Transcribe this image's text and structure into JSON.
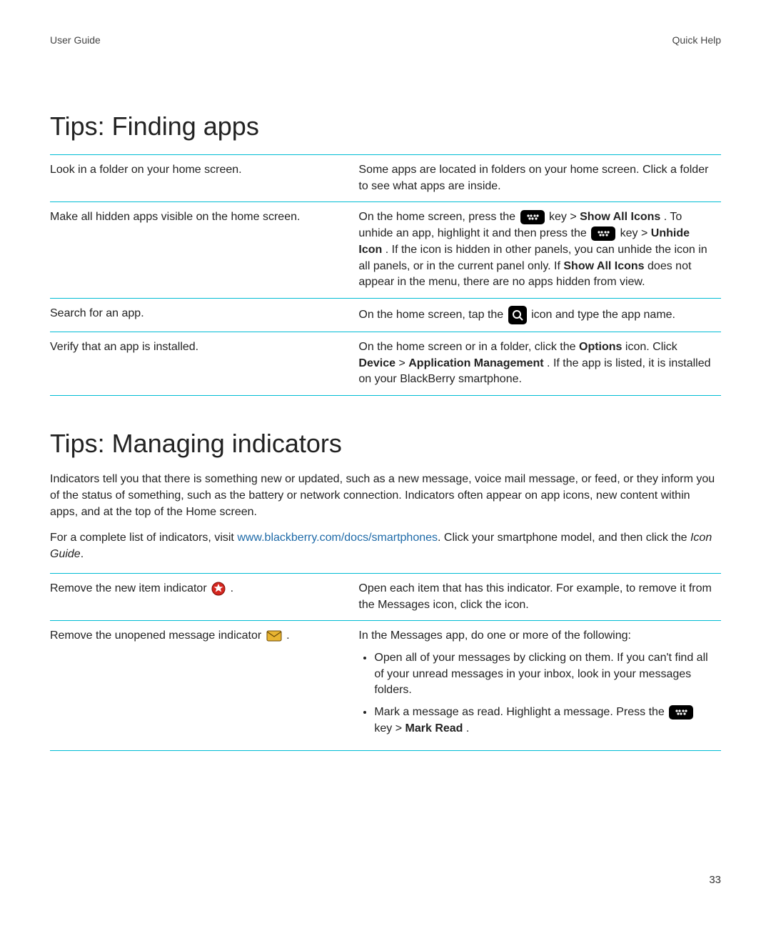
{
  "header": {
    "left": "User Guide",
    "right": "Quick Help"
  },
  "page_number": "33",
  "section1": {
    "title": "Tips: Finding apps",
    "rows": [
      {
        "left": "Look in a folder on your home screen.",
        "right_plain": "Some apps are located in folders on your home screen. Click a folder to see what apps are inside."
      },
      {
        "left": "Make all hidden apps visible on the home screen.",
        "r2a": "On the home screen, press the ",
        "r2b": " key > ",
        "r2c": "Show All Icons",
        "r2d": ". To unhide an app, highlight it and then press the ",
        "r2e": " key > ",
        "r2f": "Unhide Icon",
        "r2g": ". If the icon is hidden in other panels, you can unhide the icon in all panels, or in the current panel only. If ",
        "r2h": "Show All Icons",
        "r2i": " does not appear in the menu, there are no apps hidden from view."
      },
      {
        "left": "Search for an app.",
        "r3a": "On the home screen, tap the ",
        "r3b": " icon and type the app name."
      },
      {
        "left": "Verify that an app is installed.",
        "r4a": "On the home screen or in a folder, click the ",
        "r4b": "Options",
        "r4c": " icon. Click ",
        "r4d": "Device",
        "r4e": " > ",
        "r4f": "Application Management",
        "r4g": ". If the app is listed, it is installed on your BlackBerry smartphone."
      }
    ]
  },
  "section2": {
    "title": "Tips: Managing indicators",
    "intro": "Indicators tell you that there is something new or updated, such as a new message, voice mail message, or feed, or they inform you of the status of something, such as the battery or network connection. Indicators often appear on app icons, new content within apps, and at the top of the Home screen.",
    "link_pre": "For a complete list of indicators, visit ",
    "link_text": "www.blackberry.com/docs/smartphones",
    "link_post_a": ". Click your smartphone model, and then click the ",
    "link_post_italic": "Icon Guide",
    "link_post_b": ".",
    "rows": [
      {
        "left_a": "Remove the new item indicator ",
        "left_b": " .",
        "right": "Open each item that has this indicator. For example, to remove it from the Messages icon, click the icon."
      },
      {
        "left_a": "Remove the unopened message indicator ",
        "left_b": " .",
        "right_intro": "In the Messages app, do one or more of the following:",
        "bullet1": "Open all of your messages by clicking on them. If you can't find all of your unread messages in your inbox, look in your messages folders.",
        "bullet2a": "Mark a message as read. Highlight a message. Press the ",
        "bullet2b": " key > ",
        "bullet2c": "Mark Read",
        "bullet2d": "."
      }
    ]
  }
}
